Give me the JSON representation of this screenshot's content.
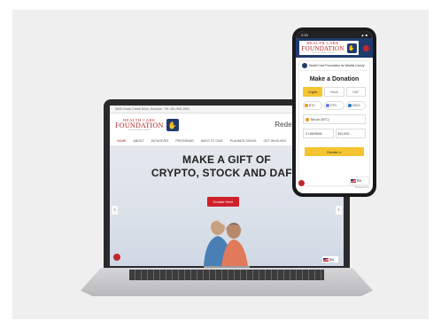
{
  "laptop": {
    "topbar_text": "5625 Cedar Creek Drive, Houston · Tel: 281-990-1900",
    "logo": {
      "line1": "HEALTH CARE",
      "line2": "FOUNDATION",
      "line3": "THE POSSIBLE SPIRIT"
    },
    "tagline": "Redefining Health C",
    "nav": [
      "HOME",
      "ABOUT",
      "INITIATIVES",
      "PROGRAMS",
      "WAYS TO GIVE",
      "PLANNED GIVING",
      "GET INVOLVED"
    ],
    "hero_line1": "MAKE A GIFT OF",
    "hero_line2": "CRYPTO, STOCK AND DAF'S",
    "donate_label": "Donate Here",
    "prev": "‹",
    "next": "›",
    "lang": "EN"
  },
  "phone": {
    "time": "2:19",
    "status_right": "▲ ■",
    "logo": {
      "line1": "HEALTH CARE",
      "line2": "FOUNDATION",
      "line3": "THE POSSIBLE SPIRIT"
    },
    "org": "Health Care Foundation for Wasilla County",
    "title": "Make a Donation",
    "tabs": [
      "Crypto",
      "Stock",
      "DAF"
    ],
    "coins": [
      "BTC",
      "ETH",
      "USDC"
    ],
    "select": "Bitcoin (BTC)",
    "amount_btc": "0.15609545",
    "amount_usd": "$10,000...",
    "donate_label": "Donate ⇨",
    "powered": "Powered by",
    "lang": "EN"
  },
  "colors": {
    "brand_red": "#d0202a",
    "navy": "#1f3b6e",
    "yellow": "#f4c531"
  }
}
